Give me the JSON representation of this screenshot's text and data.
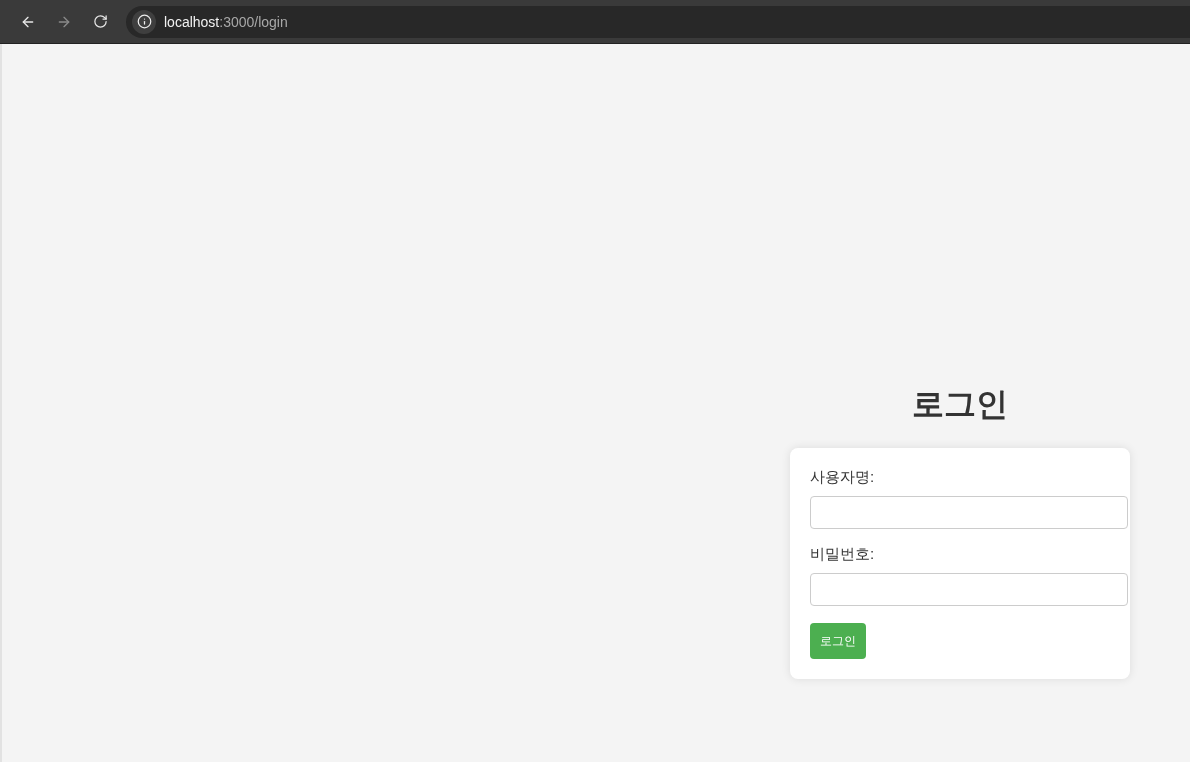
{
  "browser": {
    "url_host": "localhost",
    "url_path": ":3000/login",
    "forward_disabled": true
  },
  "login": {
    "title": "로그인",
    "fields": [
      {
        "label": "사용자명:"
      },
      {
        "label": "비밀번호:"
      }
    ],
    "button": "로그인"
  }
}
